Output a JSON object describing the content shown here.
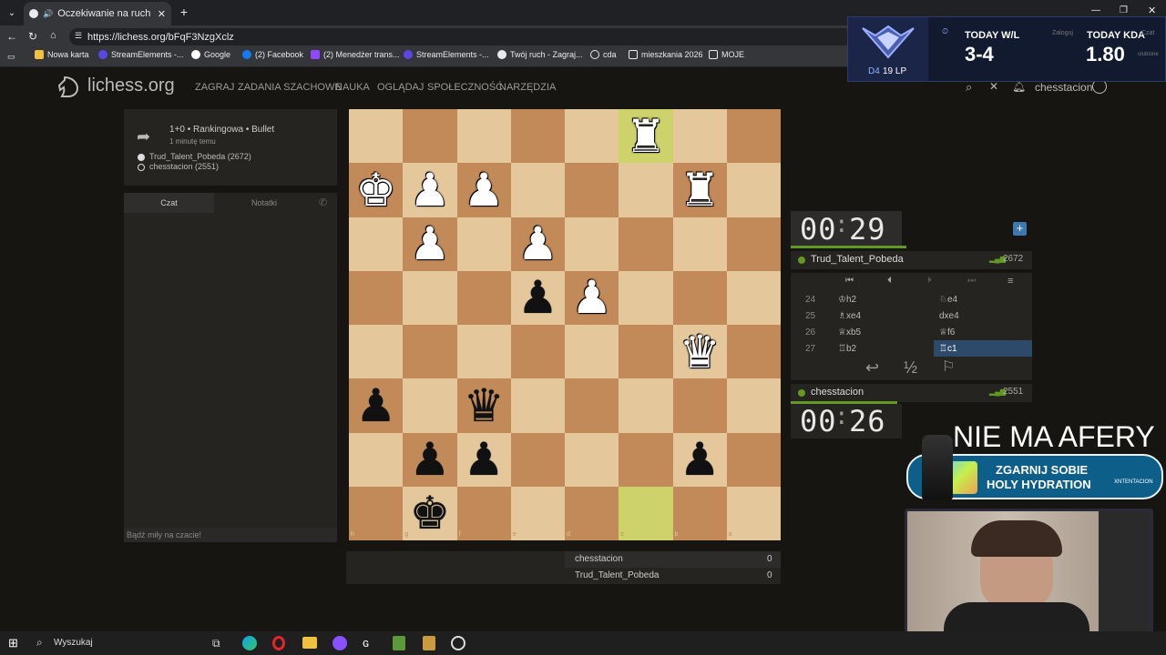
{
  "browser": {
    "tab_title": "Oczekiwanie na ruch przeciwn",
    "url": "https://lichess.org/bFqF3NzgXclz",
    "bookmarks": [
      "Nowa karta",
      "StreamElements -...",
      "Google",
      "(2) Facebook",
      "(2) Menedżer trans...",
      "StreamElements -...",
      "Twój ruch - Zagraj...",
      "cda",
      "mieszkania 2026",
      "MOJE"
    ]
  },
  "lichess": {
    "logo": "lichess.org",
    "nav": [
      "ZAGRAJ",
      "ZADANIA SZACHOWE",
      "NAUKA",
      "OGLĄDAJ",
      "SPOŁECZNOŚĆ",
      "NARZĘDZIA"
    ],
    "username": "chesstacion"
  },
  "game_info": {
    "type": "1+0 • Rankingowa • Bullet",
    "time_ago": "1 minutę temu",
    "white": "Trud_Talent_Pobeda (2672)",
    "black": "chesstacion (2551)"
  },
  "chat": {
    "tab_chat": "Czat",
    "tab_notes": "Notatki",
    "placeholder": "Bądź miły na czacie!"
  },
  "board": {
    "rank_labels": [
      "1",
      "2",
      "3",
      "4",
      "5",
      "6",
      "7",
      "8"
    ],
    "file_labels": [
      "h",
      "g",
      "f",
      "e",
      "d",
      "c",
      "b",
      "a"
    ],
    "pieces": [
      {
        "sq": "c1",
        "glyph": "♜",
        "color": "white"
      },
      {
        "sq": "h2",
        "glyph": "♚",
        "color": "white"
      },
      {
        "sq": "g2",
        "glyph": "♟",
        "color": "white"
      },
      {
        "sq": "f2",
        "glyph": "♟",
        "color": "white"
      },
      {
        "sq": "b2",
        "glyph": "♜",
        "color": "white"
      },
      {
        "sq": "g3",
        "glyph": "♟",
        "color": "white"
      },
      {
        "sq": "e3",
        "glyph": "♟",
        "color": "white"
      },
      {
        "sq": "e4",
        "glyph": "♟",
        "color": "black"
      },
      {
        "sq": "d4",
        "glyph": "♟",
        "color": "white"
      },
      {
        "sq": "b5",
        "glyph": "♛",
        "color": "white"
      },
      {
        "sq": "h6",
        "glyph": "♟",
        "color": "black"
      },
      {
        "sq": "f6",
        "glyph": "♛",
        "color": "black"
      },
      {
        "sq": "g7",
        "glyph": "♟",
        "color": "black"
      },
      {
        "sq": "f7",
        "glyph": "♟",
        "color": "black"
      },
      {
        "sq": "b7",
        "glyph": "♟",
        "color": "black"
      },
      {
        "sq": "g8",
        "glyph": "♚",
        "color": "black"
      }
    ],
    "highlights": [
      "c1",
      "c8"
    ]
  },
  "clocks": {
    "top": {
      "min": "00",
      "sec": "29",
      "player": "Trud_Talent_Pobeda",
      "rating": "2672"
    },
    "bottom": {
      "min": "00",
      "sec": "26",
      "player": "chesstacion",
      "rating": "2551"
    }
  },
  "moves": [
    {
      "n": "24",
      "w": "♔h2",
      "b": "♘e4"
    },
    {
      "n": "25",
      "w": "♗xe4",
      "b": "dxe4"
    },
    {
      "n": "26",
      "w": "♕xb5",
      "b": "♕f6"
    },
    {
      "n": "27",
      "w": "♖b2",
      "b": "♖c1"
    }
  ],
  "action_icons": [
    "takeback-icon",
    "draw-offer-icon",
    "resign-flag-icon"
  ],
  "draw_label": "½",
  "score_table": [
    {
      "name": "chesstacion",
      "score": "0"
    },
    {
      "name": "Trud_Talent_Pobeda",
      "score": "0"
    }
  ],
  "overlay": {
    "rank": "D4",
    "lp": "19 LP",
    "wl_label": "TODAY W/L",
    "wl_value": "3-4",
    "kda_label": "TODAY KDA",
    "kda_value": "1.80",
    "zaloguj": "Zaloguj",
    "czat": "Czat",
    "ulubione": "ulubione",
    "headline": "NIE MA AFERY",
    "banner_line1": "ZGARNIJ SOBIE",
    "banner_line2": "HOLY HYDRATION",
    "banner_tag": "XNTENTACION"
  },
  "taskbar": {
    "search": "Wyszukaj"
  },
  "colors": {
    "light_sq": "#e4c89c",
    "dark_sq": "#c28a58",
    "highlight": "#cdd26a",
    "accent_green": "#629924"
  }
}
